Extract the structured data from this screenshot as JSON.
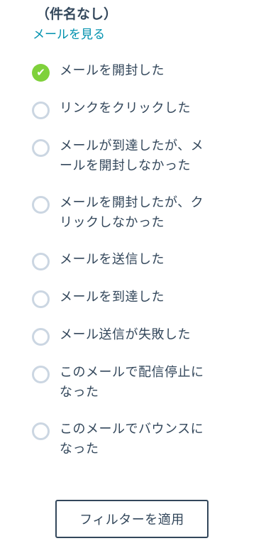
{
  "header": {
    "subject": "（件名なし）",
    "view_mail_link": "メールを見る"
  },
  "options": [
    {
      "label": "メールを開封した",
      "checked": true
    },
    {
      "label": "リンクをクリックした",
      "checked": false
    },
    {
      "label": "メールが到達したが、メ\nールを開封しなかった",
      "checked": false
    },
    {
      "label": "メールを開封したが、ク\nリックしなかった",
      "checked": false
    },
    {
      "label": "メールを送信した",
      "checked": false
    },
    {
      "label": "メールを到達した",
      "checked": false
    },
    {
      "label": "メール送信が失敗した",
      "checked": false
    },
    {
      "label": "このメールで配信停止に\nなった",
      "checked": false
    },
    {
      "label": "このメールでバウンスに\nなった",
      "checked": false
    }
  ],
  "apply_button": {
    "label": "フィルターを適用"
  },
  "colors": {
    "accent_green": "#7fd13b",
    "link_blue": "#0091ae",
    "text": "#33475b",
    "radio_border": "#cbd6e2"
  },
  "icons": {
    "checked": "check-icon"
  }
}
